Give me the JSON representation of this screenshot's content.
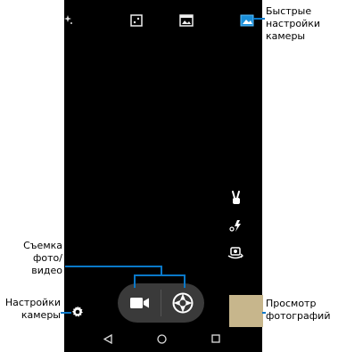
{
  "labels": {
    "quick_settings": [
      "Быстрые",
      "настройки",
      "камеры"
    ],
    "shoot": [
      "Съемка",
      "фото/",
      "видео"
    ],
    "camera_settings": [
      "Настройки",
      "камеры"
    ],
    "gallery": [
      "Просмотр",
      "фотографий"
    ]
  },
  "top_bar": {
    "icons": [
      "sparkle-icon",
      "hdr-icon",
      "panorama-mode-icon",
      "scene-mode-icon"
    ]
  },
  "side_controls": {
    "icons": [
      "gesture-shot-icon",
      "flash-auto-icon",
      "switch-camera-icon"
    ]
  },
  "bottom_controls": {
    "video_button": "video-camera-icon",
    "shutter_button": "shutter-icon",
    "settings_button": "gear-icon",
    "gallery_thumbnail": "last-photo-thumbnail"
  },
  "nav_bar": {
    "buttons": [
      "back-icon",
      "home-icon",
      "recents-icon"
    ]
  },
  "colors": {
    "viewfinder_background": "#000000",
    "callout_line": "#0a78c8",
    "thumbnail": "#c7b68c"
  }
}
